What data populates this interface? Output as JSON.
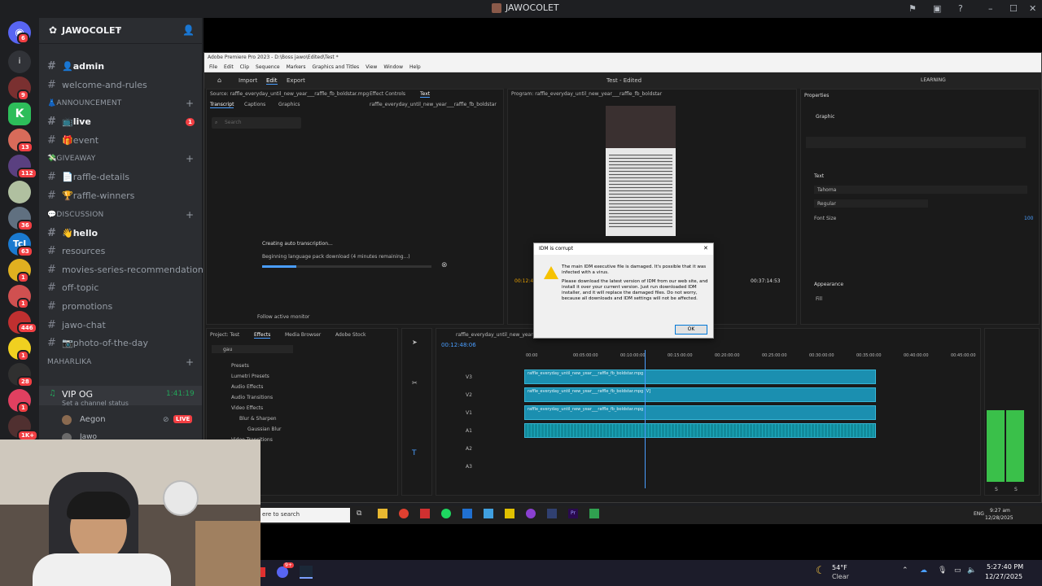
{
  "window": {
    "title": "JAWOCOLET"
  },
  "server": {
    "name": "JAWOCOLET",
    "rail_badges": [
      "6",
      "9",
      "13",
      "112",
      "36",
      "63",
      "1",
      "1",
      "446",
      "1",
      "28",
      "1",
      "1K+"
    ]
  },
  "channels": [
    {
      "type": "channel",
      "label": "👤admin",
      "bright": true
    },
    {
      "type": "channel",
      "label": "welcome-and-rules"
    },
    {
      "type": "category",
      "label": "👗ANNOUNCEMENT"
    },
    {
      "type": "channel",
      "label": "📺live",
      "bright": true,
      "badge": "1"
    },
    {
      "type": "channel",
      "label": "🎁event"
    },
    {
      "type": "category",
      "label": "💸GIVEAWAY"
    },
    {
      "type": "channel",
      "label": "📄raffle-details"
    },
    {
      "type": "channel",
      "label": "🏆raffle-winners"
    },
    {
      "type": "category",
      "label": "💬DISCUSSION"
    },
    {
      "type": "channel",
      "label": "👋hello",
      "bright": true
    },
    {
      "type": "channel",
      "label": "resources"
    },
    {
      "type": "channel",
      "label": "movies-series-recommendations"
    },
    {
      "type": "channel",
      "label": "off-topic"
    },
    {
      "type": "channel",
      "label": "promotions"
    },
    {
      "type": "channel",
      "label": "jawo-chat"
    },
    {
      "type": "channel",
      "label": "📷photo-of-the-day"
    },
    {
      "type": "category",
      "label": "MAHARLIKA"
    }
  ],
  "voice": {
    "channel": "VIP OG",
    "timer": "1:41:19",
    "status": "Set a channel status",
    "users": [
      {
        "name": "Aegon",
        "live": "LIVE"
      },
      {
        "name": "Jawo"
      }
    ]
  },
  "premiere": {
    "title_bar": "Adobe Premiere Pro 2023 - D:\\Boss jawo\\Edited\\Test *",
    "menu": [
      "File",
      "Edit",
      "Clip",
      "Sequence",
      "Markers",
      "Graphics and Titles",
      "View",
      "Window",
      "Help"
    ],
    "header_tabs": [
      "Import",
      "Edit",
      "Export"
    ],
    "header_center": "Test - Edited",
    "header_right": "LEARNING",
    "source_label": "Source: raffle_everyday_until_new_year___raffle_fb_boldstar.mpg",
    "source_tabs": [
      "Effect Controls",
      "Text"
    ],
    "transcript_tabs": [
      "Transcript",
      "Captions",
      "Graphics"
    ],
    "transcript_clip": "raffle_everyday_until_new_year___raffle_fb_boldstar",
    "search_placeholder": "Search",
    "transcription_title": "Creating auto transcription...",
    "transcription_status": "Beginning language pack download (4 minutes remaining...)",
    "transcription_progress": 0.2,
    "follow_monitor": "Follow active monitor",
    "program_label": "Program: raffle_everyday_until_new_year___raffle_fb_boldstar",
    "program_tc_left": "00:12:4",
    "program_tc_right": "00:37:14:53",
    "properties": {
      "title": "Properties",
      "graphic": "Graphic",
      "text": "Text",
      "font": "Tahoma",
      "style": "Regular",
      "font_size_label": "Font Size",
      "font_size": "100",
      "appearance": "Appearance",
      "fill": "Fill"
    },
    "project_tabs": [
      "Project: Test",
      "Effects",
      "Media Browser",
      "Adobe Stock"
    ],
    "effects_search": "gau",
    "effects_tree": [
      "Presets",
      "Lumetri Presets",
      "Audio Effects",
      "Audio Transitions",
      "Video Effects",
      "Blur & Sharpen",
      "Gaussian Blur",
      "Video Transitions"
    ],
    "timeline_label": "raffle_everyday_until_new_year___raffle_fb_boldstar",
    "timeline_tc": "00:12:48:06",
    "ruler": [
      "00:00",
      "00:05:00:00",
      "00:10:00:00",
      "00:15:00:00",
      "00:20:00:00",
      "00:25:00:00",
      "00:30:00:00",
      "00:35:00:00",
      "00:40:00:00",
      "00:45:00:00"
    ],
    "tracks": [
      "V3",
      "V2",
      "V1",
      "A1",
      "A2",
      "A3"
    ],
    "clips": [
      "raffle_everyday_until_new_year___raffle_fb_boldstar.mpg",
      "raffle_everyday_until_new_year___raffle_fb_boldstar.mpg [V]",
      "raffle_everyday_until_new_year___raffle_fb_boldstar.mpg"
    ],
    "meter_labels": [
      "S",
      "S"
    ]
  },
  "dialog": {
    "title": "IDM is corrupt",
    "line1": "The main IDM executive file is damaged. It's possible that it was infected with a virus.",
    "line2": "Please download the latest version of IDM from our web site, and install it over your current version. Just run downloaded IDM installer, and it will replace the damaged files. Do not worry, because all downloads and IDM settings will not be affected.",
    "ok": "OK"
  },
  "inner_taskbar": {
    "search": "ere to search",
    "lang": "ENG",
    "time": "9:27 am",
    "date": "12/28/2025"
  },
  "outer_taskbar": {
    "discord_badge": "9+",
    "weather_temp": "54°F",
    "weather_desc": "Clear",
    "time": "5:27:40 PM",
    "date": "12/27/2025"
  },
  "colors": {
    "discord_bg": "#1e1f22",
    "channel_bg": "#2b2d31",
    "accent_red": "#f23f43",
    "voice_green": "#23a55a",
    "premiere_clip": "#1b8fb0",
    "premiere_blue": "#4a9eff"
  }
}
